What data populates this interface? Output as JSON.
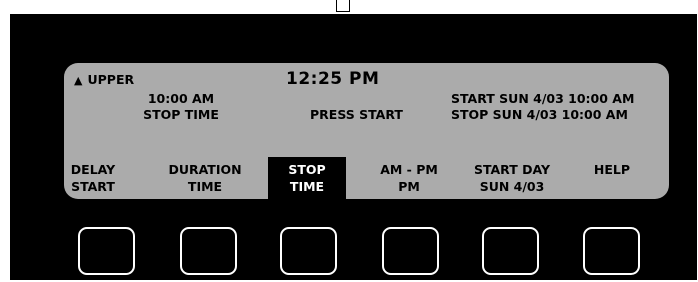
{
  "header": {
    "zone": "UPPER",
    "zone_icon": "triangle-up-icon",
    "clock": "12:25 PM"
  },
  "status": {
    "time_value": "10:00 AM",
    "time_label": "STOP TIME",
    "prompt": "PRESS START",
    "start_line": "START SUN  4/03 10:00 AM",
    "stop_line": "STOP SUN 4/03 10:00 AM"
  },
  "softkeys": [
    {
      "line1": "DELAY",
      "line2": "START",
      "active": false
    },
    {
      "line1": "DURATION",
      "line2": "TIME",
      "active": false
    },
    {
      "line1": "STOP",
      "line2": "TIME",
      "active": true
    },
    {
      "line1": "AM - PM",
      "line2": "PM",
      "active": false
    },
    {
      "line1": "START DAY",
      "line2": "SUN  4/03",
      "active": false
    },
    {
      "line1": "",
      "line2": "HELP",
      "active": false
    }
  ],
  "colors": {
    "panel": "#000000",
    "lcd": "#ababab",
    "text": "#000000",
    "active_key_bg": "#000000",
    "active_key_text": "#ffffff",
    "button_outline": "#ffffff"
  }
}
